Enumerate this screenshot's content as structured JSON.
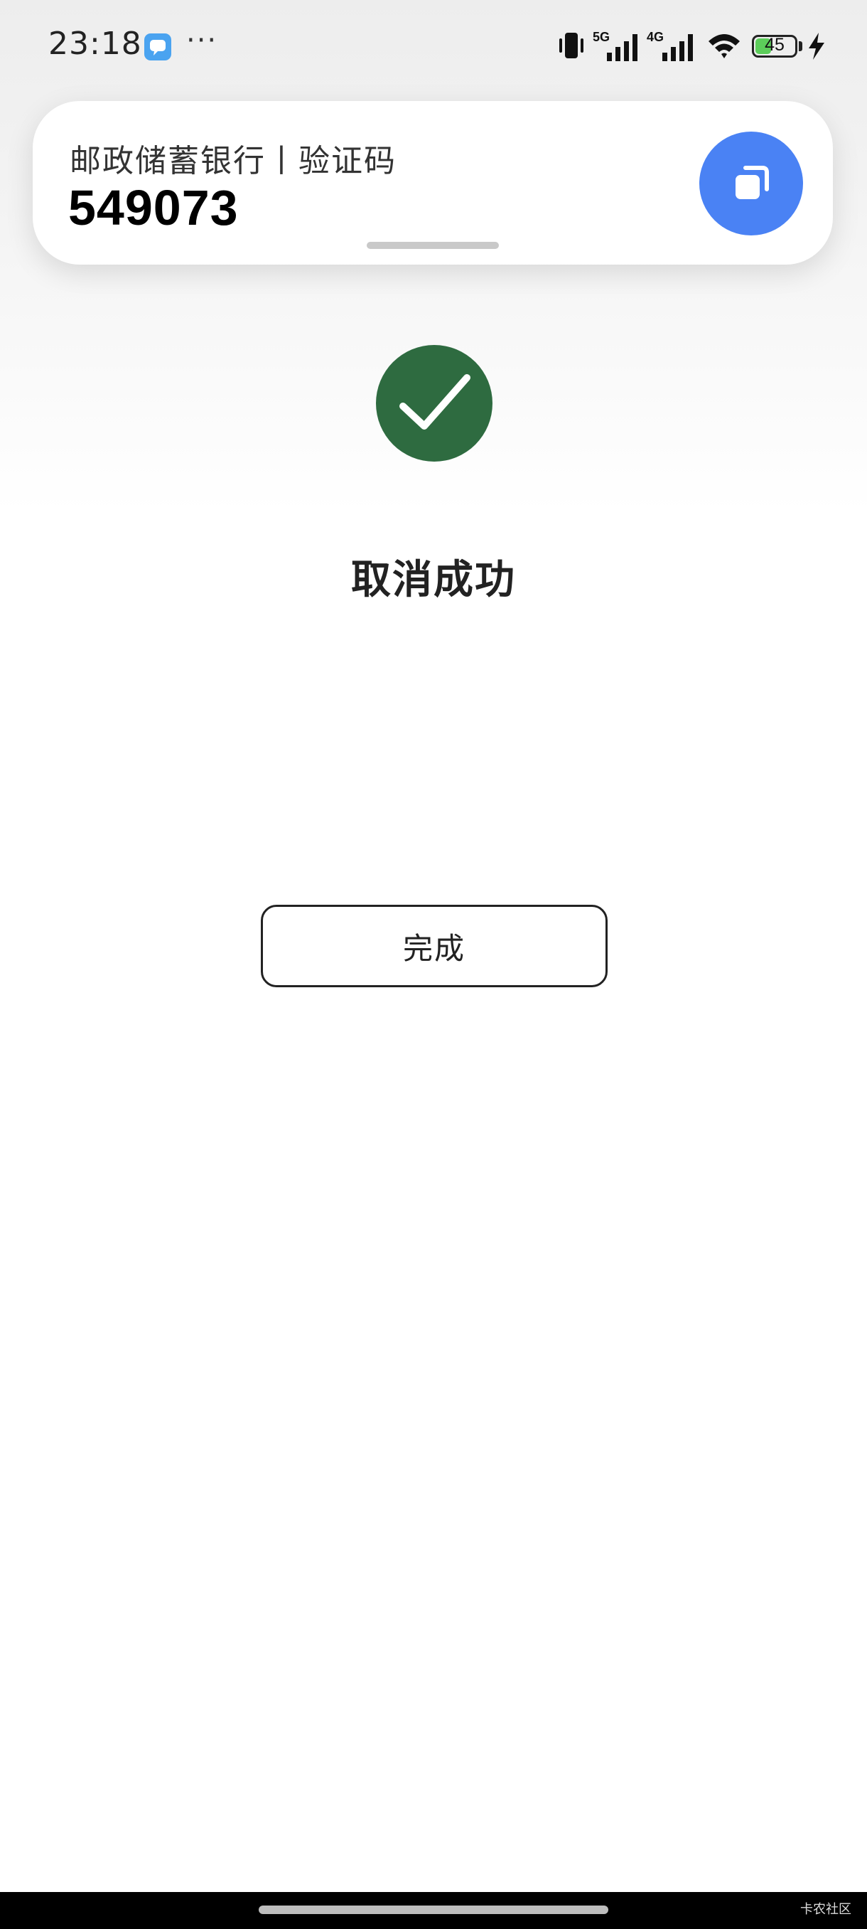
{
  "status_bar": {
    "time": "23:18",
    "more": "···",
    "network_1": "5G",
    "network_2": "4G",
    "battery_level": 45,
    "battery_text": "45",
    "icons": [
      "message-app-icon",
      "vibrate-icon",
      "signal-5g-icon",
      "signal-4g-icon",
      "wifi-icon",
      "battery-icon",
      "charging-icon"
    ]
  },
  "notification": {
    "title": "邮政储蓄银行丨验证码",
    "code": "549073",
    "copy_icon": "copy-icon",
    "accent_color": "#4a82f4"
  },
  "result": {
    "icon": "check-icon",
    "icon_color": "#2e6b40",
    "title": "取消成功",
    "done_label": "完成"
  },
  "footer": {
    "watermark": "卡农社区"
  }
}
